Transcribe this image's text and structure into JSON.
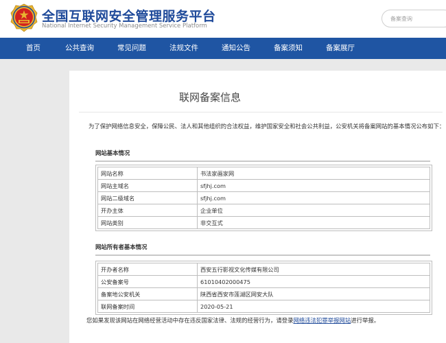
{
  "header": {
    "title": "全国互联网安全管理服务平台",
    "subtitle": "National Internet Security Management Service Platform",
    "search_placeholder": "备案查询"
  },
  "nav": [
    "首页",
    "公共查询",
    "常见问题",
    "法规文件",
    "通知公告",
    "备案须知",
    "备案展厅"
  ],
  "page": {
    "title": "联网备案信息",
    "intro": "为了保护网络信息安全，保障公民、法人和其他组织的合法权益，维护国家安全和社会公共利益，公安机关将备案网站的基本情况公布如下："
  },
  "website_section": {
    "title": "网站基本情况",
    "rows": [
      {
        "label": "网站名称",
        "value": "书法家画家网"
      },
      {
        "label": "网站主域名",
        "value": "sfjhj.com"
      },
      {
        "label": "网站二级域名",
        "value": "sfjhj.com"
      },
      {
        "label": "开办主体",
        "value": "企业单位"
      },
      {
        "label": "网站类别",
        "value": "非交互式"
      }
    ]
  },
  "owner_section": {
    "title": "网站所有者基本情况",
    "rows": [
      {
        "label": "开办者名称",
        "value": "西安五行影视文化传媒有限公司"
      },
      {
        "label": "公安备案号",
        "value": "61010402000475"
      },
      {
        "label": "备案地公安机关",
        "value": "陕西省西安市莲湖区网安大队"
      },
      {
        "label": "联网备案时间",
        "value": "2020-05-21"
      }
    ]
  },
  "footer": {
    "prefix": "您如果发现该网站在网络经营活动中存在违反国家法律、法规的经营行为，请登录",
    "link": "网络违法犯罪举报网站",
    "suffix": "进行举报。"
  },
  "colors": {
    "brand_blue": "#1f55a3",
    "title_blue": "#1f4a9a",
    "emblem_red": "#d2231f",
    "emblem_gold": "#e8b530"
  }
}
